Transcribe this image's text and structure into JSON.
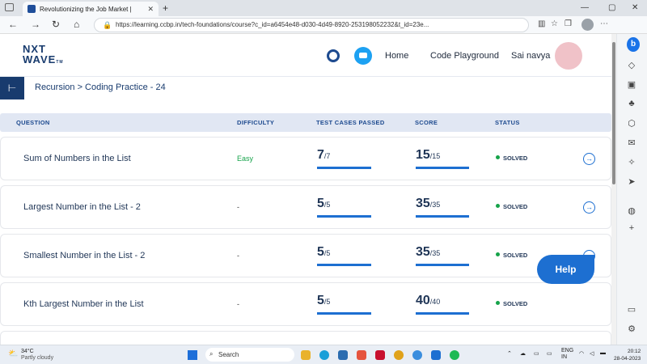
{
  "browser": {
    "tab_title": "Revolutionizing the Job Market |",
    "url": "https://learning.ccbp.in/tech-foundations/course?c_id=a6454e48-d030-4d49-8920-253198052232&t_id=23e..."
  },
  "header": {
    "logo_line1": "NXT",
    "logo_line2": "WAVE",
    "logo_tm": "TM",
    "nav_home": "Home",
    "nav_code": "Code Playground",
    "user_name": "Sai navya"
  },
  "breadcrumb": {
    "text": "Recursion > Coding Practice - 24"
  },
  "table": {
    "headers": [
      "QUESTION",
      "DIFFICULTY",
      "TEST CASES PASSED",
      "SCORE",
      "STATUS"
    ],
    "rows": [
      {
        "question": "Sum of Numbers in the List",
        "difficulty": "Easy",
        "passed": "7",
        "total": "/7",
        "score": "15",
        "score_total": "/15",
        "status": "SOLVED"
      },
      {
        "question": "Largest Number in the List - 2",
        "difficulty": "-",
        "passed": "5",
        "total": "/5",
        "score": "35",
        "score_total": "/35",
        "status": "SOLVED"
      },
      {
        "question": "Smallest Number in the List - 2",
        "difficulty": "-",
        "passed": "5",
        "total": "/5",
        "score": "35",
        "score_total": "/35",
        "status": "SOLVED"
      },
      {
        "question": "Kth Largest Number in the List",
        "difficulty": "-",
        "passed": "5",
        "total": "/5",
        "score": "40",
        "score_total": "/40",
        "status": "SOLVED"
      }
    ]
  },
  "help_label": "Help",
  "taskbar": {
    "temp": "34°C",
    "weather": "Partly cloudy",
    "search": "Search",
    "lang1": "ENG",
    "lang2": "IN",
    "time": "20:12",
    "date": "28-04-2023"
  },
  "colors": {
    "brand": "#183b6e",
    "accent": "#1d6fd1",
    "success": "#16a34a"
  }
}
